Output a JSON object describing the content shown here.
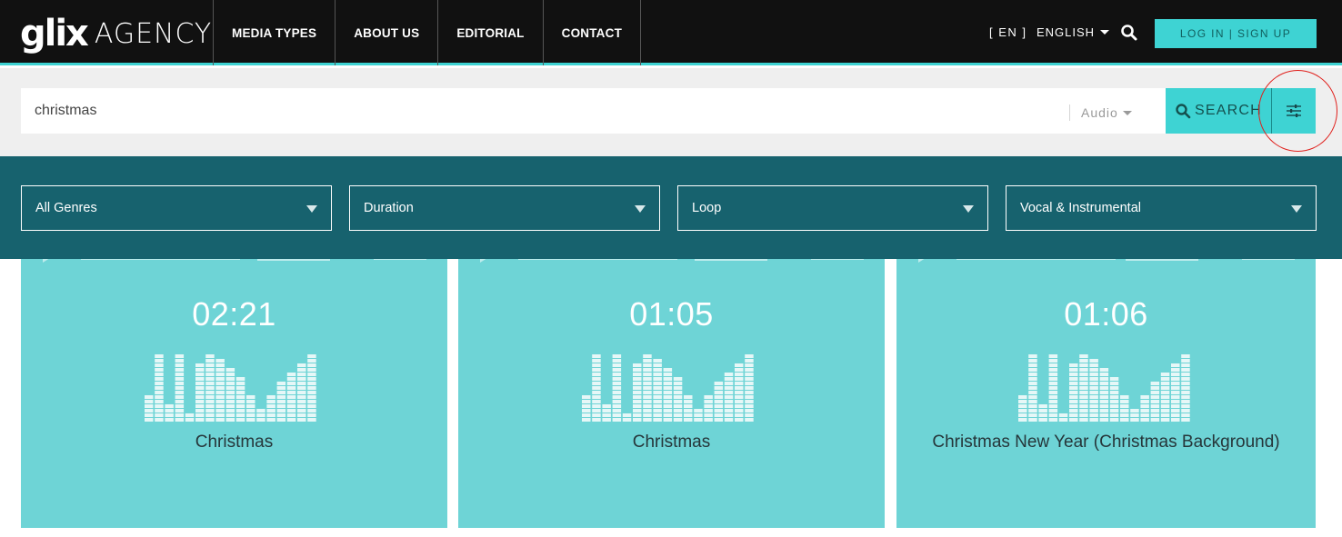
{
  "header": {
    "logo_mark": "glix",
    "logo_text": "AGENCY",
    "nav": [
      "MEDIA TYPES",
      "ABOUT US",
      "EDITORIAL",
      "CONTACT"
    ],
    "lang_code": "[ EN ]",
    "language": "ENGLISH",
    "login_label": "LOG IN | SIGN UP"
  },
  "search": {
    "query": "christmas",
    "media_type": "Audio",
    "search_label": "SEARCH"
  },
  "filters": [
    {
      "label": "All Genres"
    },
    {
      "label": "Duration"
    },
    {
      "label": "Loop"
    },
    {
      "label": "Vocal & Instrumental"
    }
  ],
  "results": [
    {
      "duration": "02:21",
      "title": "Christmas"
    },
    {
      "duration": "01:05",
      "title": "Christmas"
    },
    {
      "duration": "01:06",
      "title": "Christmas New Year (Christmas Background)"
    }
  ],
  "colors": {
    "accent": "#3ed3d3",
    "filter_bar": "#17626e",
    "card": "#6ed4d6",
    "header": "#111111",
    "annotation": "#e0201c"
  },
  "icons": {
    "search": "search-icon",
    "filter": "sliders-icon",
    "dropdown": "caret-down-icon",
    "equalizer": "equalizer-icon"
  }
}
